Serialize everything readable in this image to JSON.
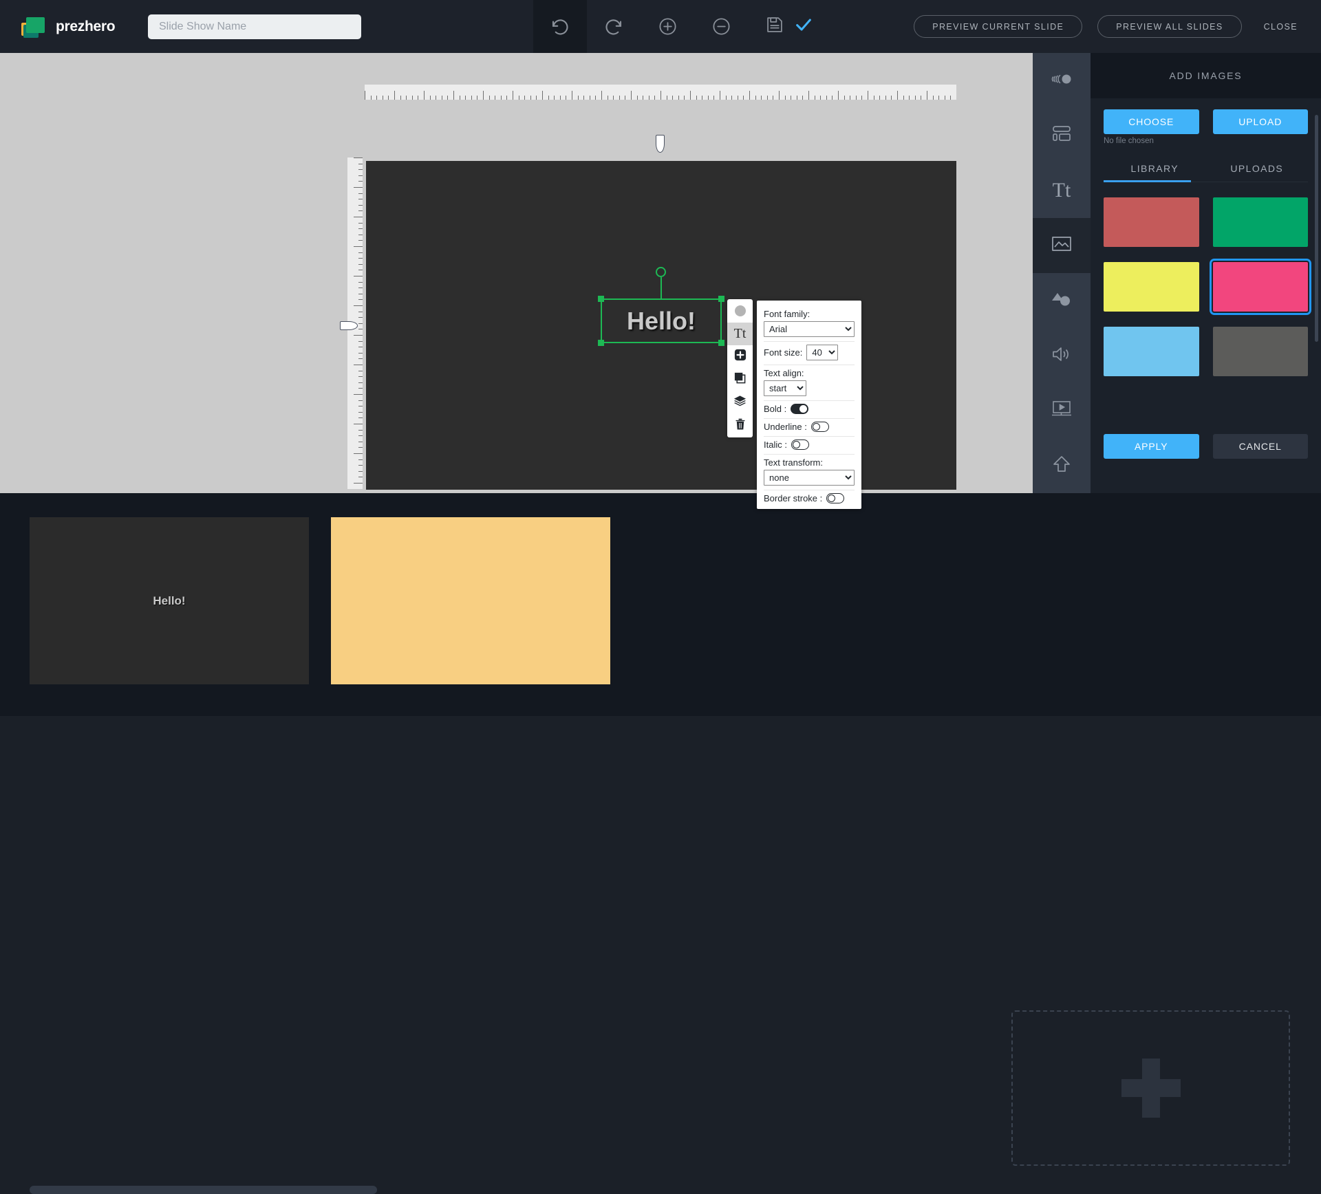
{
  "header": {
    "brand_name": "prezhero",
    "title_placeholder": "Slide Show Name",
    "title_value": "",
    "tools": [
      {
        "name": "undo-button",
        "icon": "undo-icon",
        "active": true
      },
      {
        "name": "redo-button",
        "icon": "redo-icon",
        "active": false
      },
      {
        "name": "zoom-in-button",
        "icon": "plus-circle-icon",
        "active": false
      },
      {
        "name": "zoom-out-button",
        "icon": "minus-circle-icon",
        "active": false
      }
    ],
    "save_icon": "floppy-disk-icon",
    "saved_icon": "check-icon",
    "saved_color": "#41b3f9",
    "preview_current_label": "PREVIEW CURRENT SLIDE",
    "preview_all_label": "PREVIEW ALL SLIDES",
    "close_label": "CLOSE"
  },
  "canvas": {
    "background": "#2d2d2d",
    "text_object": {
      "content": "Hello!",
      "color": "#c9c9c9",
      "selection_color": "#1db954"
    }
  },
  "object_toolbar": {
    "items": [
      {
        "name": "color-swatch-button",
        "icon": "circle-icon",
        "selected": false
      },
      {
        "name": "text-tool-button",
        "icon": "text-tt-icon",
        "selected": true
      },
      {
        "name": "add-element-button",
        "icon": "plus-square-icon",
        "selected": false
      },
      {
        "name": "duplicate-button",
        "icon": "copy-icon",
        "selected": false
      },
      {
        "name": "layers-button",
        "icon": "layers-icon",
        "selected": false
      },
      {
        "name": "delete-button",
        "icon": "trash-icon",
        "selected": false
      }
    ]
  },
  "text_properties": {
    "font_family_label": "Font family:",
    "font_family_value": "Arial",
    "font_family_options": [
      "Arial"
    ],
    "font_size_label": "Font size:",
    "font_size_value": "40",
    "font_size_options": [
      "40"
    ],
    "text_align_label": "Text align:",
    "text_align_value": "start",
    "text_align_options": [
      "start"
    ],
    "bold_label": "Bold :",
    "bold_value": true,
    "underline_label": "Underline :",
    "underline_value": false,
    "italic_label": "Italic :",
    "italic_value": false,
    "text_transform_label": "Text transform:",
    "text_transform_value": "none",
    "text_transform_options": [
      "none"
    ],
    "border_stroke_label": "Border stroke :",
    "border_stroke_value": false
  },
  "rail": {
    "items": [
      {
        "name": "sidebar-item-transitions",
        "icon": "motion-icon",
        "active": false
      },
      {
        "name": "sidebar-item-layouts",
        "icon": "layout-icon",
        "active": false
      },
      {
        "name": "sidebar-item-text",
        "icon": "text-tt-icon",
        "active": false
      },
      {
        "name": "sidebar-item-images",
        "icon": "image-icon",
        "active": true
      },
      {
        "name": "sidebar-item-shapes",
        "icon": "shapes-icon",
        "active": false
      },
      {
        "name": "sidebar-item-audio",
        "icon": "speaker-icon",
        "active": false
      },
      {
        "name": "sidebar-item-video",
        "icon": "video-icon",
        "active": false
      },
      {
        "name": "sidebar-item-upload",
        "icon": "upload-arrow-icon",
        "active": false
      }
    ]
  },
  "panel": {
    "title": "ADD IMAGES",
    "choose_label": "CHOOSE",
    "upload_label": "UPLOAD",
    "no_file_text": "No file chosen",
    "tabs": [
      {
        "label": "LIBRARY",
        "active": true
      },
      {
        "label": "UPLOADS",
        "active": false
      }
    ],
    "swatches": [
      {
        "name": "library-image-1",
        "color": "#c45a5a",
        "selected": false
      },
      {
        "name": "library-image-2",
        "color": "#02a568",
        "selected": false
      },
      {
        "name": "library-image-3",
        "color": "#edee5d",
        "selected": false
      },
      {
        "name": "library-image-4",
        "color": "#f2467e",
        "selected": true
      },
      {
        "name": "library-image-5",
        "color": "#70c5ef",
        "selected": false
      },
      {
        "name": "library-image-6",
        "color": "#5c5c5a",
        "selected": false
      }
    ],
    "apply_label": "APPLY",
    "cancel_label": "CANCEL"
  },
  "filmstrip": {
    "slides": [
      {
        "name": "slide-thumbnail-1",
        "background": "#2b2b2b",
        "text": "Hello!"
      },
      {
        "name": "slide-thumbnail-2",
        "background": "#f8cf82",
        "text": ""
      }
    ],
    "add_slide_icon": "plus-icon"
  }
}
